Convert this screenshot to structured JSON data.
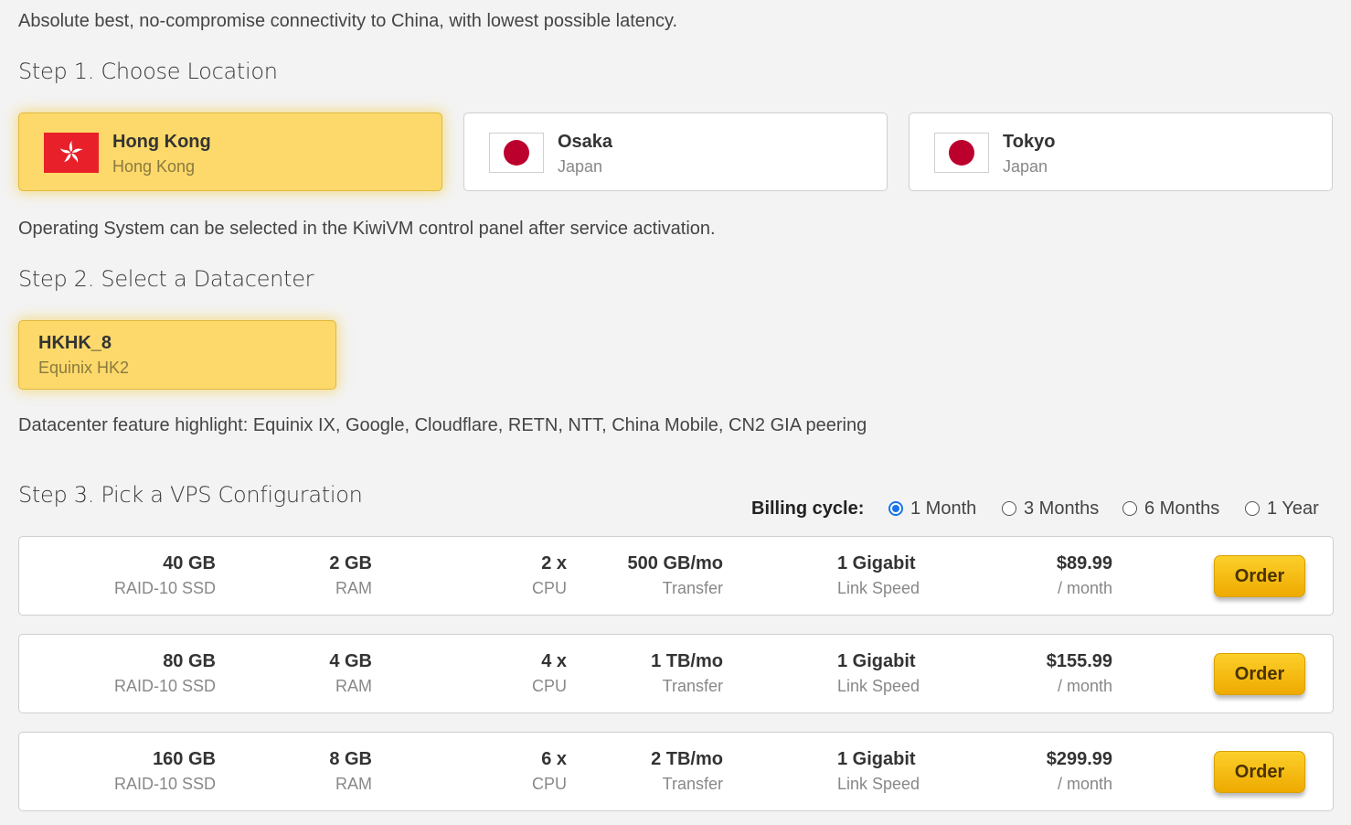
{
  "intro": "Absolute best, no-compromise connectivity to China, with lowest possible latency.",
  "step1": {
    "title": "Step 1. Choose Location",
    "locations": [
      {
        "name": "Hong Kong",
        "region": "Hong Kong",
        "flag": "hong-kong-flag-icon",
        "selected": true
      },
      {
        "name": "Osaka",
        "region": "Japan",
        "flag": "japan-flag-icon",
        "selected": false
      },
      {
        "name": "Tokyo",
        "region": "Japan",
        "flag": "japan-flag-icon",
        "selected": false
      }
    ]
  },
  "os_note": "Operating System can be selected in the KiwiVM control panel after service activation.",
  "step2": {
    "title": "Step 2. Select a Datacenter",
    "datacenter": {
      "name": "HKHK_8",
      "facility": "Equinix HK2",
      "selected": true
    }
  },
  "datacenter_note": "Datacenter feature highlight: Equinix IX, Google, Cloudflare, RETN, NTT, China Mobile, CN2 GIA peering",
  "step3": {
    "title": "Step 3. Pick a VPS Configuration",
    "billing": {
      "label": "Billing cycle:",
      "options": [
        "1 Month",
        "3 Months",
        "6 Months",
        "1 Year"
      ],
      "selected": "1 Month"
    },
    "plans": [
      {
        "disk": "40 GB",
        "disk_type": "RAID-10 SSD",
        "ram": "2 GB",
        "ram_label": "RAM",
        "cpu": "2 x",
        "cpu_label": "CPU",
        "transfer": "500 GB/mo",
        "transfer_label": "Transfer",
        "link": "1 Gigabit",
        "link_label": "Link Speed",
        "price": "$89.99",
        "period": "/ month",
        "order_label": "Order"
      },
      {
        "disk": "80 GB",
        "disk_type": "RAID-10 SSD",
        "ram": "4 GB",
        "ram_label": "RAM",
        "cpu": "4 x",
        "cpu_label": "CPU",
        "transfer": "1 TB/mo",
        "transfer_label": "Transfer",
        "link": "1 Gigabit",
        "link_label": "Link Speed",
        "price": "$155.99",
        "period": "/ month",
        "order_label": "Order"
      },
      {
        "disk": "160 GB",
        "disk_type": "RAID-10 SSD",
        "ram": "8 GB",
        "ram_label": "RAM",
        "cpu": "6 x",
        "cpu_label": "CPU",
        "transfer": "2 TB/mo",
        "transfer_label": "Transfer",
        "link": "1 Gigabit",
        "link_label": "Link Speed",
        "price": "$299.99",
        "period": "/ month",
        "order_label": "Order"
      }
    ]
  },
  "colors": {
    "selected_bg": "#fcd96a",
    "order_button": "#f5bb00",
    "radio_checked": "#1a73e8",
    "japan_red": "#bc002d",
    "hk_red": "#e8202a"
  }
}
